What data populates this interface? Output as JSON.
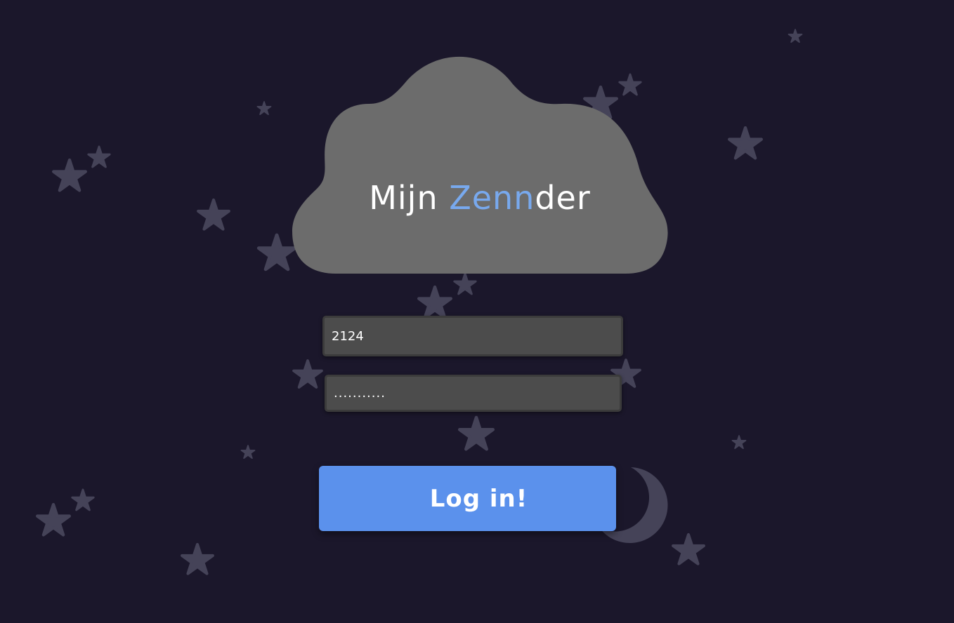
{
  "logo": {
    "prefix": "Mijn ",
    "brand_highlight": "Zenn",
    "brand_rest": "der"
  },
  "form": {
    "username_value": "2124",
    "password_value": "...........",
    "submit_label": "Log in!"
  },
  "colors": {
    "background": "#1b172b",
    "cloud": "#6c6c6c",
    "brand_highlight": "#78a9ee",
    "button": "#5b91ec",
    "input": "#4c4c4c",
    "decoration": "#454358"
  },
  "icons": {
    "background_stars": "star-icon",
    "moon": "crescent-moon-icon",
    "cloud": "cloud-shape"
  }
}
